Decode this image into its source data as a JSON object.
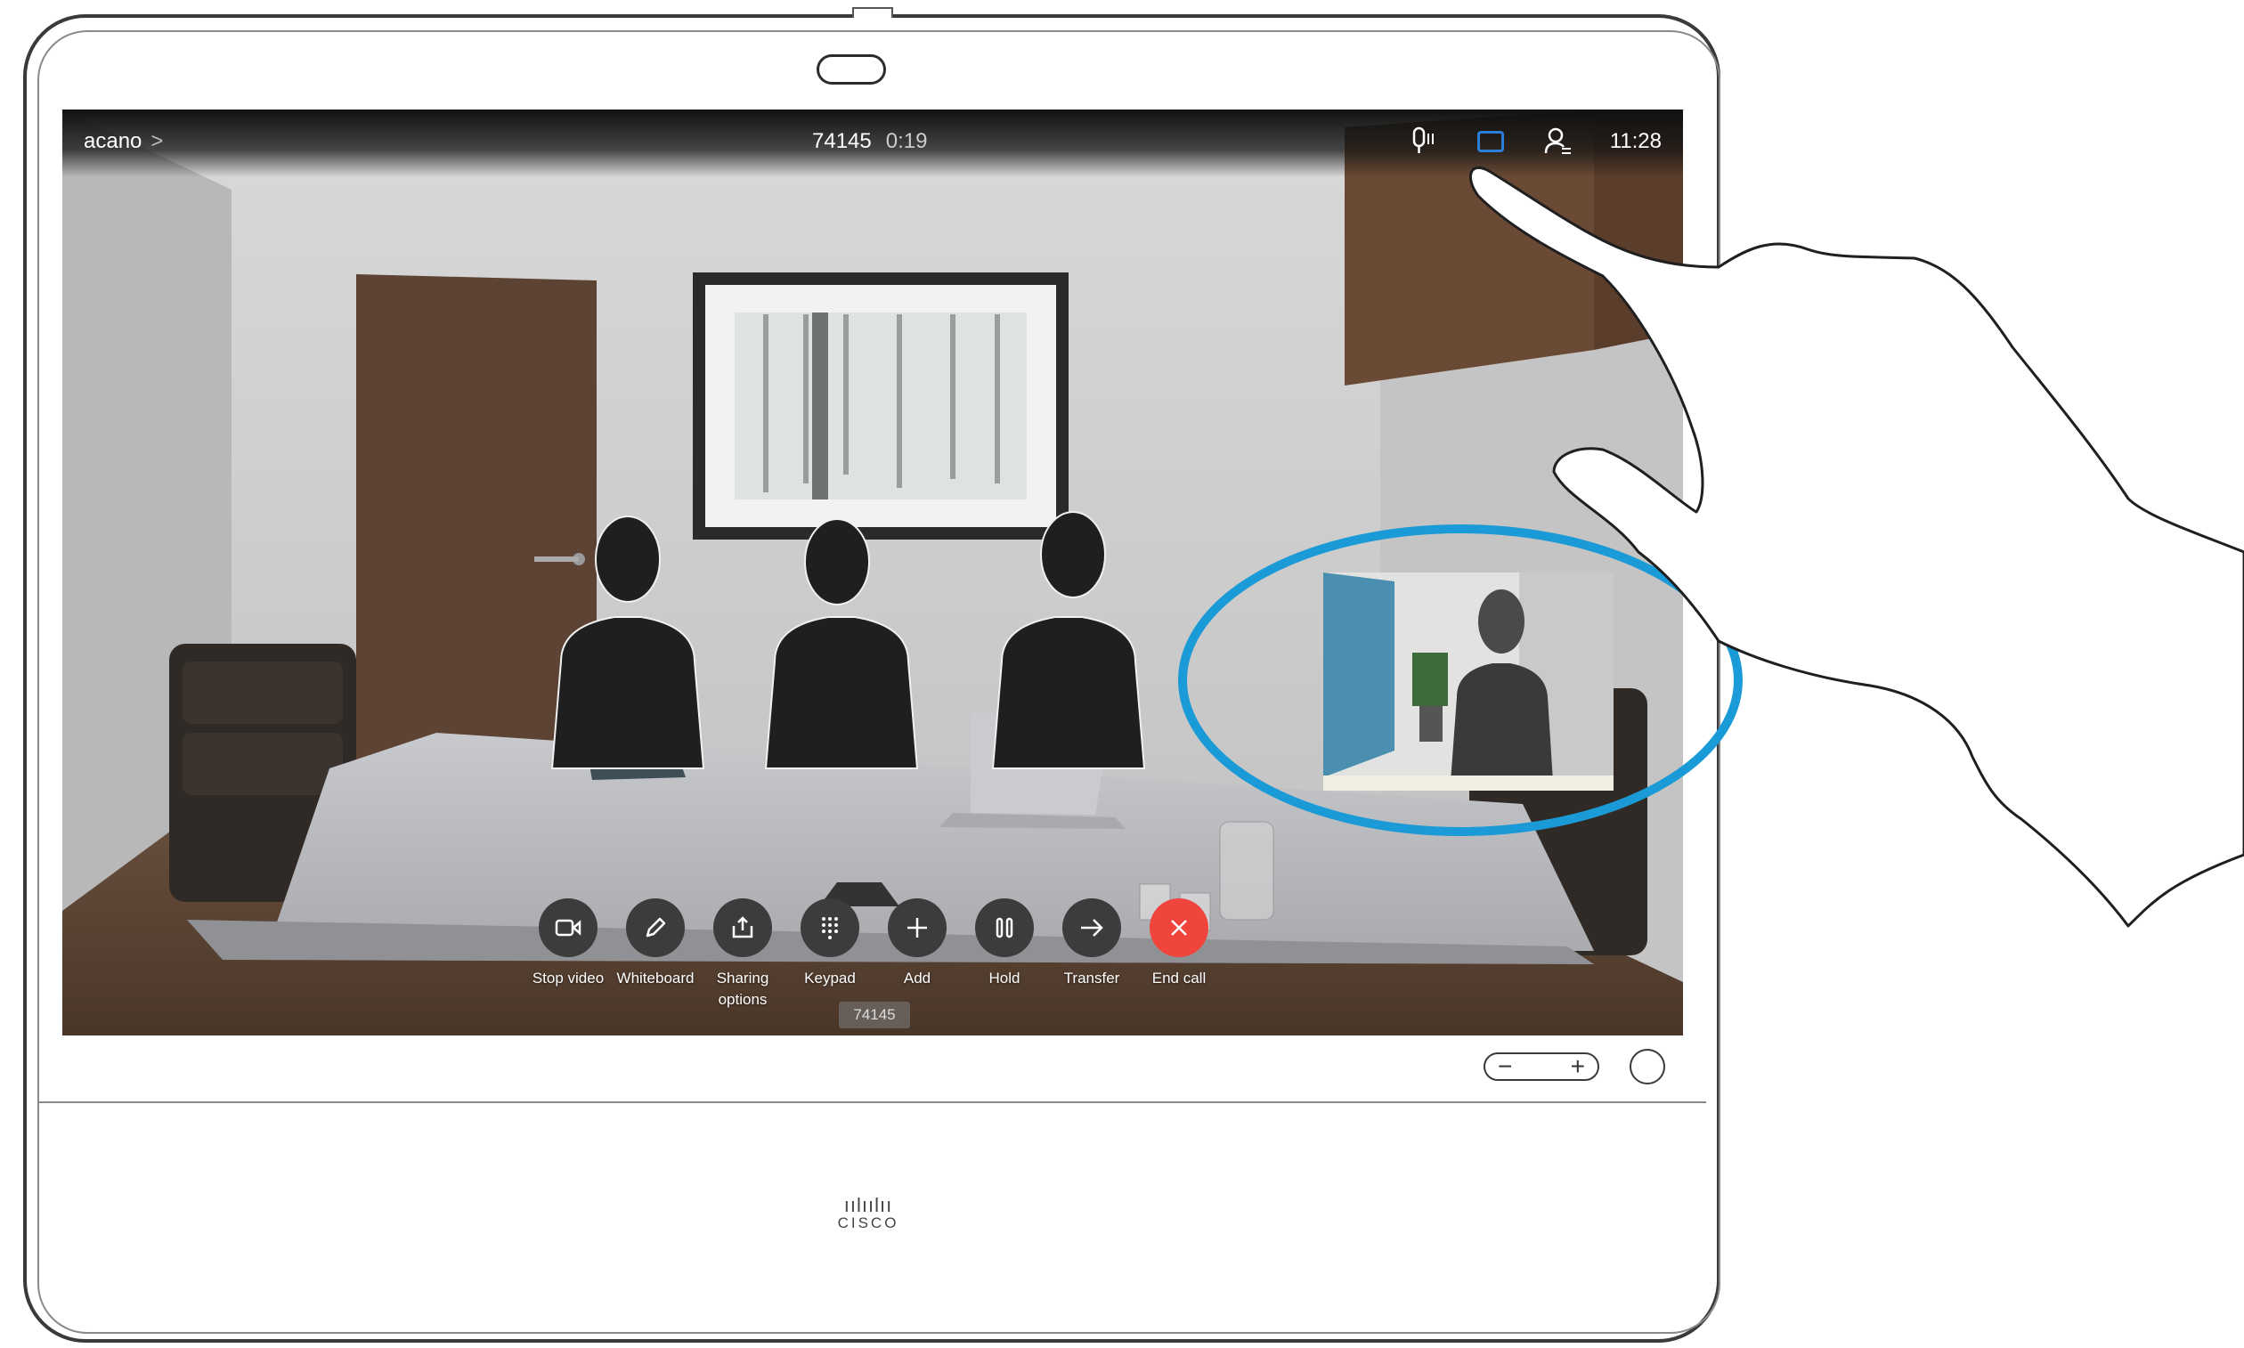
{
  "topbar": {
    "call_name": "acano",
    "call_name_chevron": ">",
    "call_number": "74145",
    "call_duration": "0:19",
    "time": "11:28",
    "icons": [
      "microphone-icon",
      "self-view-icon",
      "participants-icon"
    ]
  },
  "controls": [
    {
      "id": "stop-video",
      "label": "Stop video",
      "icon": "video-camera-icon"
    },
    {
      "id": "whiteboard",
      "label": "Whiteboard",
      "icon": "pencil-icon"
    },
    {
      "id": "sharing-options",
      "label": "Sharing\noptions",
      "icon": "share-icon"
    },
    {
      "id": "keypad",
      "label": "Keypad",
      "icon": "keypad-icon"
    },
    {
      "id": "add",
      "label": "Add",
      "icon": "plus-icon"
    },
    {
      "id": "hold",
      "label": "Hold",
      "icon": "pause-icon"
    },
    {
      "id": "transfer",
      "label": "Transfer",
      "icon": "arrow-right-icon"
    },
    {
      "id": "end-call",
      "label": "End call",
      "icon": "close-icon"
    }
  ],
  "tooltip_number": "74145",
  "volume": {
    "minus": "−",
    "plus": "+"
  },
  "brand": {
    "bars": "ıılıılıı",
    "name": "CISCO"
  },
  "colors": {
    "end_call": "#f0453c",
    "highlight_ring": "#1a9ad6",
    "self_view_active": "#2b7fd6"
  }
}
